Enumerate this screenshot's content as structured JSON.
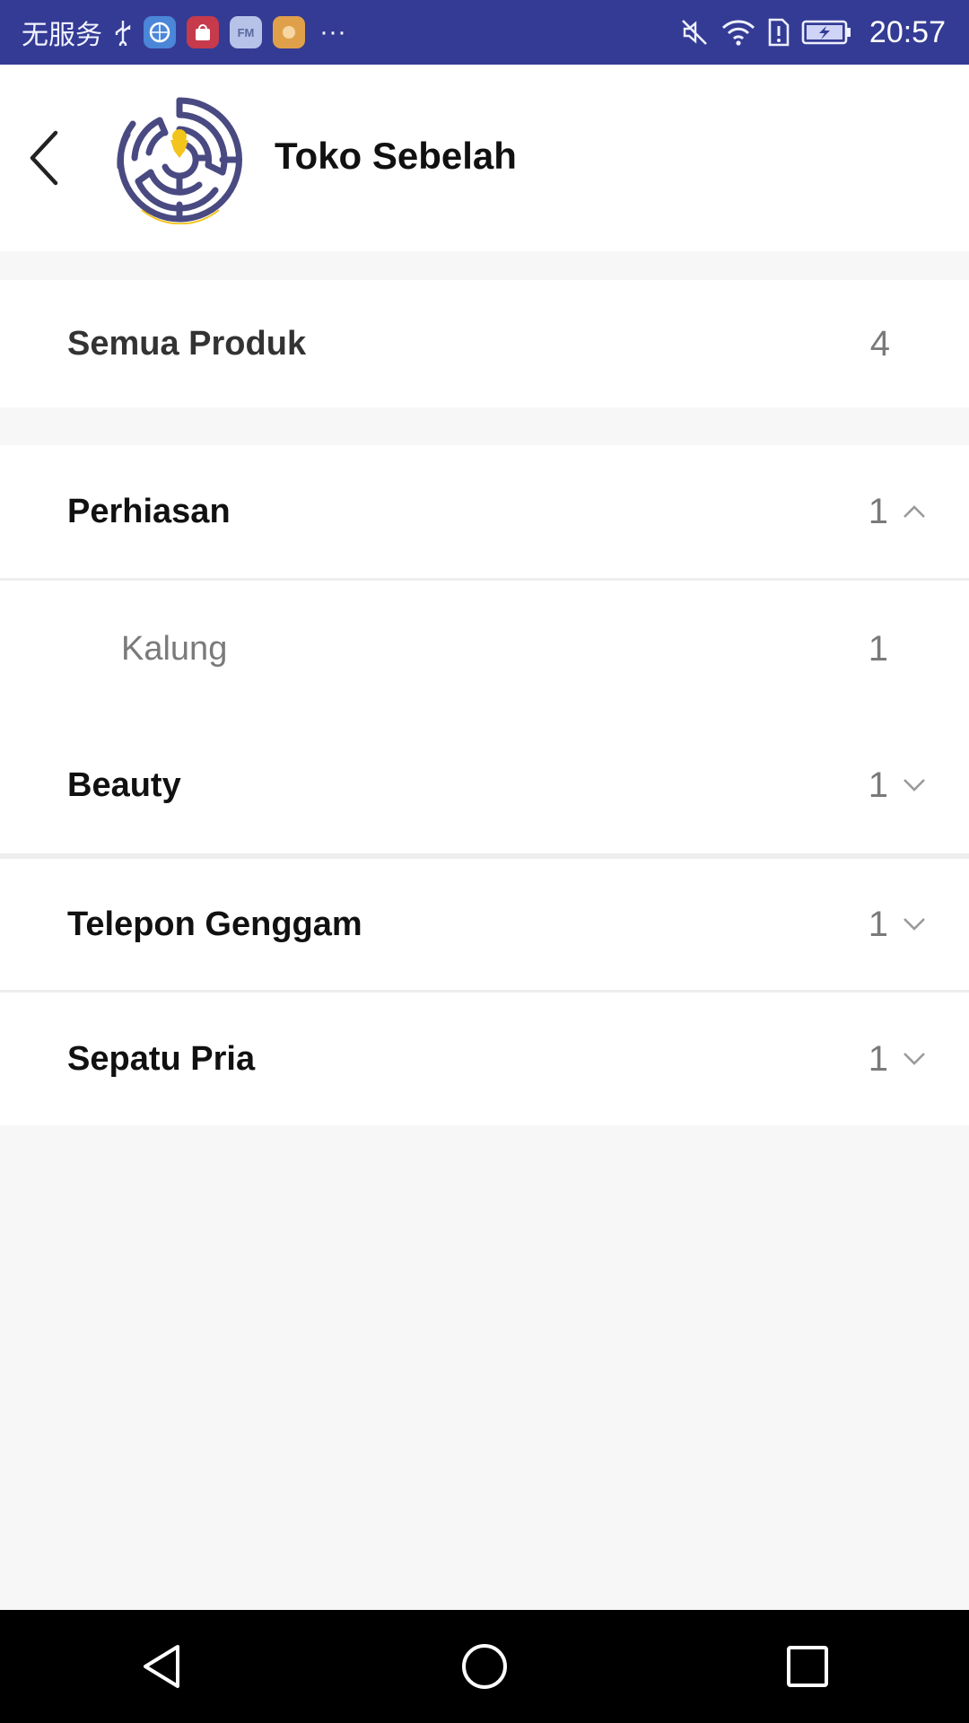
{
  "status_bar": {
    "carrier": "无服务",
    "time": "20:57",
    "app_icons": [
      {
        "name": "browser-app-icon",
        "color": "#4b86d8"
      },
      {
        "name": "shop-app-icon",
        "color": "#c63a4c"
      },
      {
        "name": "fm-app-icon",
        "color": "#b6c2e8",
        "label": "FM"
      },
      {
        "name": "photo-app-icon",
        "color": "#e0a04a"
      }
    ],
    "more": "···"
  },
  "header": {
    "title": "Toko Sebelah",
    "back_icon": "chevron-left-icon",
    "logo_icon": "maze-logo"
  },
  "all_products": {
    "label": "Semua Produk",
    "count": "4"
  },
  "categories": [
    {
      "label": "Perhiasan",
      "count": "1",
      "expanded": true,
      "children": [
        {
          "label": "Kalung",
          "count": "1"
        }
      ]
    },
    {
      "label": "Beauty",
      "count": "1",
      "expanded": false
    },
    {
      "label": "Telepon Genggam",
      "count": "1",
      "expanded": false
    },
    {
      "label": "Sepatu Pria",
      "count": "1",
      "expanded": false
    }
  ],
  "colors": {
    "status_bar_bg": "#343b94",
    "logo_purple": "#4a4a82",
    "logo_yellow": "#f3c41c",
    "page_bg": "#f7f7f8"
  }
}
